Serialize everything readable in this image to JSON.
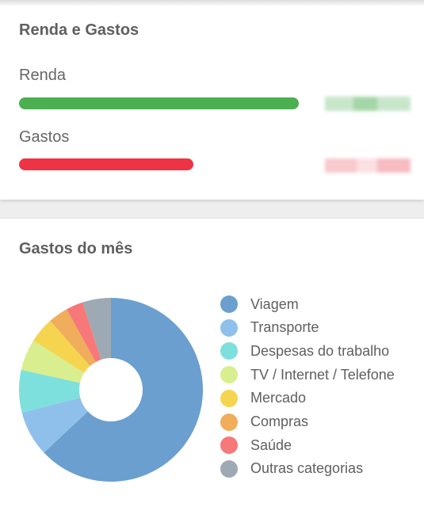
{
  "income_expenses_card": {
    "title": "Renda e Gastos",
    "income": {
      "label": "Renda",
      "ratio": 0.93,
      "color": "#4caf50"
    },
    "expenses": {
      "label": "Gastos",
      "ratio": 0.58,
      "color": "#ee3344"
    }
  },
  "monthly_expenses_card": {
    "title": "Gastos do mês"
  },
  "chart_data": {
    "type": "pie",
    "title": "Gastos do mês",
    "donut": true,
    "legend_position": "right",
    "categories": [
      "Viagem",
      "Transporte",
      "Despesas do trabalho",
      "TV / Internet / Telefone",
      "Mercado",
      "Compras",
      "Saúde",
      "Outras categorias"
    ],
    "values": [
      63,
      8,
      7.5,
      5.5,
      4.5,
      3.5,
      3,
      5
    ],
    "colors": [
      "#6a9fd0",
      "#8fc0ec",
      "#7ee0dc",
      "#d9ee8e",
      "#f5d54f",
      "#f0ad5c",
      "#f77878",
      "#9eaab3"
    ]
  }
}
